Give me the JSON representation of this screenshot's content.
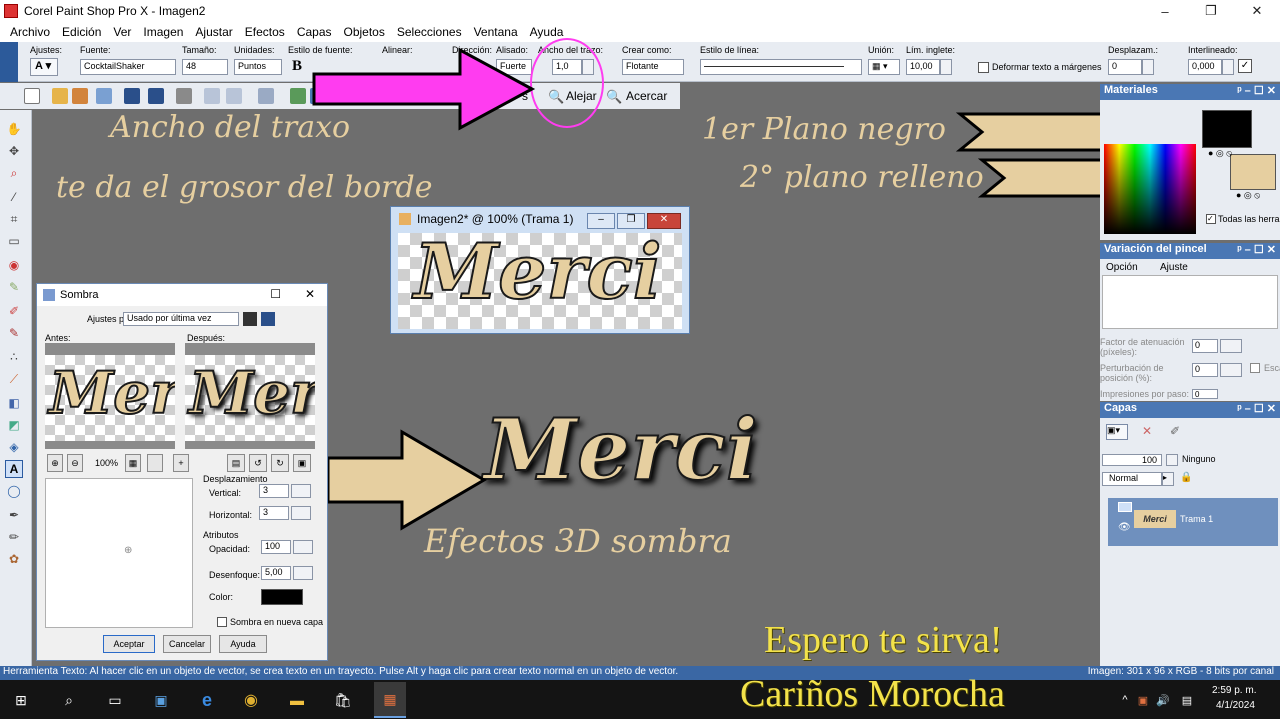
{
  "window": {
    "title": "Corel Paint Shop Pro X - Imagen2",
    "controls": [
      "–",
      "❐",
      "✕"
    ]
  },
  "menu": [
    "Archivo",
    "Edición",
    "Ver",
    "Imagen",
    "Ajustar",
    "Efectos",
    "Capas",
    "Objetos",
    "Selecciones",
    "Ventana",
    "Ayuda"
  ],
  "tool_options": {
    "presets_label": "Ajustes:",
    "font_label": "Fuente:",
    "font_value": "CocktailShaker",
    "size_label": "Tamaño:",
    "size_value": "48",
    "units_label": "Unidades:",
    "units_value": "Puntos",
    "style_label": "Estilo de fuente:",
    "bold": "B",
    "align_label": "Alinear:",
    "direction_label": "Dirección:",
    "antialias_label": "Alisado:",
    "antialias_value": "Fuerte",
    "stroke_label": "Ancho del trazo:",
    "stroke_value": "1,0",
    "create_label": "Crear como:",
    "create_value": "Flotante",
    "line_style_label": "Estilo de línea:",
    "join_label": "Unión:",
    "miter_label": "Lím. inglete:",
    "miter_value": "10,00",
    "warp_label": "Deformar texto a márgenes",
    "offset_label": "Desplazam.:",
    "offset_value": "0",
    "leading_label": "Interlineado:",
    "leading_value": "0,000"
  },
  "std_toolbar": {
    "zoom_out": "Alejar",
    "zoom_in": "Acercar",
    "partial": "s"
  },
  "canvas_notes": {
    "stroke_width": "Ancho del traxo",
    "stroke_hint": "te da el grosor del borde",
    "foreground": "1er Plano negro",
    "background": "2° plano relleno",
    "effect": "Efectos 3D sombra",
    "big_word": "Merci"
  },
  "image_window": {
    "title": "Imagen2* @ 100% (Trama 1)",
    "word": "Merci"
  },
  "sombra": {
    "title": "Sombra",
    "presets_label": "Ajustes pred.:",
    "presets_value": "Usado por última vez",
    "before_label": "Antes:",
    "after_label": "Después:",
    "zoom": "100%",
    "offset_title": "Desplazamiento",
    "vertical_label": "Vertical:",
    "vertical_value": "3",
    "horizontal_label": "Horizontal:",
    "horizontal_value": "3",
    "attrs_title": "Atributos",
    "opacity_label": "Opacidad:",
    "opacity_value": "100",
    "blur_label": "Desenfoque:",
    "blur_value": "5,00",
    "color_label": "Color:",
    "new_layer_label": "Sombra en nueva capa",
    "ok": "Aceptar",
    "cancel": "Cancelar",
    "help": "Ayuda",
    "preview_word": "Mer"
  },
  "panels": {
    "materials": "Materiales",
    "all_tools": "Todas las herra",
    "brush_variation": "Variación del pincel",
    "option_col": "Opción",
    "setting_col": "Ajuste",
    "fade_label": "Factor de atenuación (píxeles):",
    "fade_value": "0",
    "jitter_label": "Perturbación de posición (%):",
    "jitter_value": "0",
    "jitter_extra": "Esca",
    "per_step_label": "Impresiones por paso:",
    "per_step_value": "0",
    "layers": "Capas",
    "layer_opacity": "100",
    "layer_mask": "Ninguno",
    "blend_mode": "Normal",
    "layer_name": "Trama 1",
    "layer_thumb": "Merci"
  },
  "status": {
    "left": "Herramienta Texto: Al hacer clic en un objeto de vector, se crea texto en un trayecto. Pulse Alt y haga clic para crear texto normal en un objeto de vector.",
    "right": "Imagen: 301 x 96 x RGB - 8 bits por canal"
  },
  "signature": {
    "line1": "Espero te sirva!",
    "line2": "Cariños Morocha"
  },
  "taskbar": {
    "time": "2:59 p. m.",
    "date": "4/1/2024"
  },
  "colors": {
    "canvas_bg": "#6e6e6e",
    "cream": "#e6cfa0",
    "magenta": "#ff3cf0",
    "panel_blue": "#4a77b4",
    "signature": "#f3e24a"
  }
}
